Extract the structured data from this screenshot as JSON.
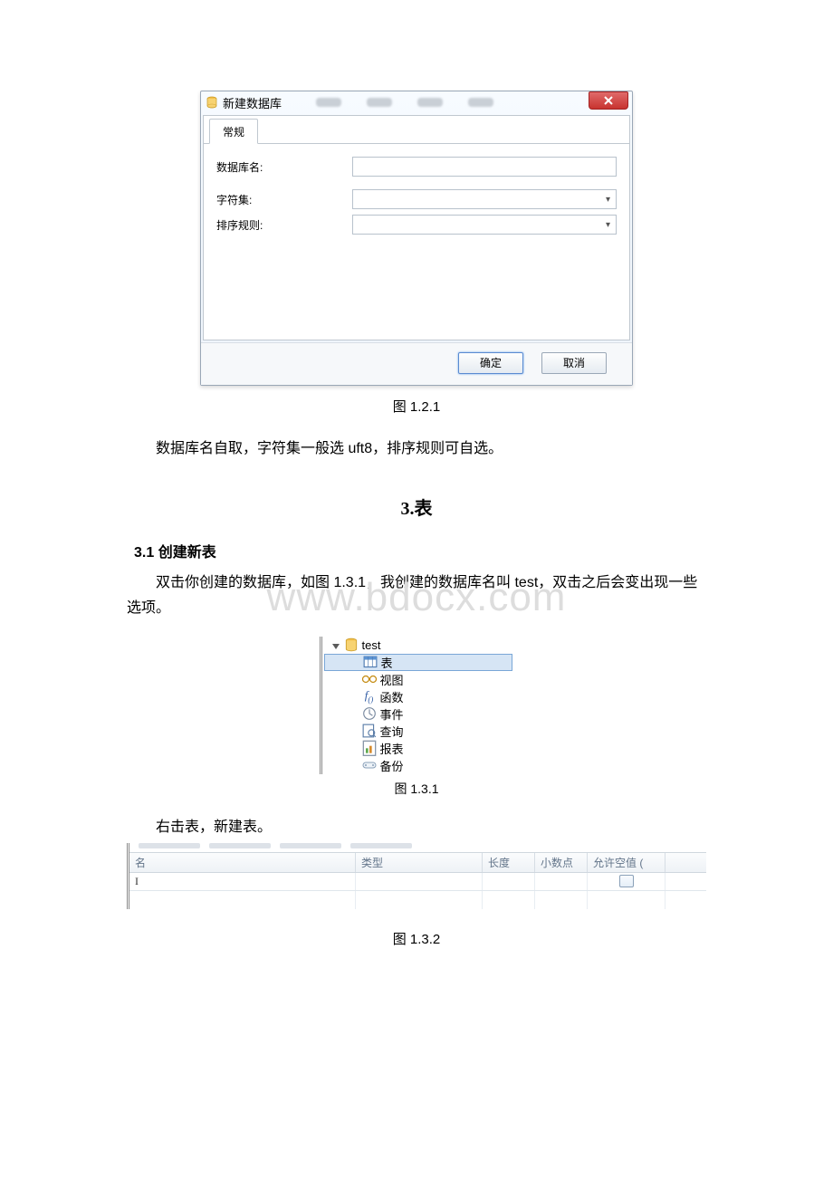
{
  "watermark": "www.bdocx.com",
  "fig121": {
    "title": "新建数据库",
    "tab": "常规",
    "labels": {
      "dbname": "数据库名:",
      "charset": "字符集:",
      "collation": "排序规则:"
    },
    "buttons": {
      "ok": "确定",
      "cancel": "取消"
    },
    "caption": "图 1.2.1"
  },
  "para1_1": "数据库名自取，字符集一般选 uft8，排序规则可自选。",
  "section3_title": "3.表",
  "sub31": "3.1 创建新表",
  "para2_1": "双击你创建的数据库，如图 1.3.1，我创建的数据库名叫 test，双击之后会变出现一些选项。",
  "fig131": {
    "root": "test",
    "items": {
      "table": "表",
      "view": "视图",
      "func": "函数",
      "event": "事件",
      "query": "查询",
      "report": "报表",
      "backup": "备份"
    },
    "caption": "图 1.3.1"
  },
  "para3_1": "右击表，新建表。",
  "fig132": {
    "headers": {
      "name": "名",
      "type": "类型",
      "len": "长度",
      "dec": "小数点",
      "null": "允许空值 ("
    },
    "caret": "I",
    "caption": "图 1.3.2"
  }
}
